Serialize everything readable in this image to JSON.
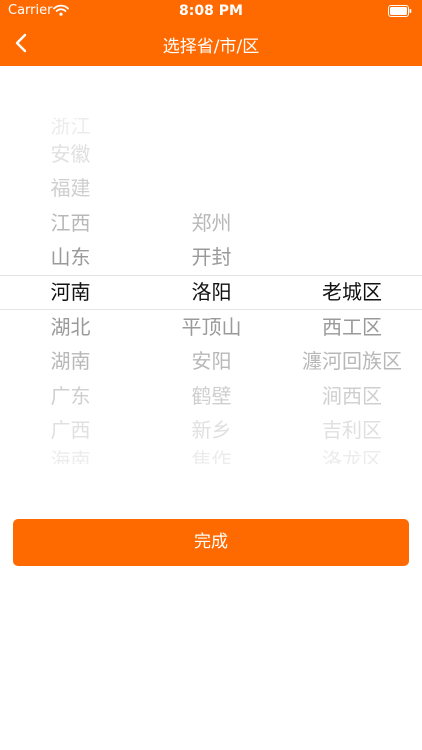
{
  "status_bar": {
    "carrier": "Carrier",
    "time": "8:08 PM"
  },
  "nav": {
    "title": "选择省/市/区"
  },
  "picker": {
    "province": {
      "items": [
        "浙江",
        "安徽",
        "福建",
        "江西",
        "山东",
        "河南",
        "湖北",
        "湖南",
        "广东",
        "广西",
        "海南"
      ],
      "selected": "河南"
    },
    "city": {
      "items": [
        "郑州",
        "开封",
        "洛阳",
        "平顶山",
        "安阳",
        "鹤壁",
        "新乡",
        "焦作"
      ],
      "selected": "洛阳"
    },
    "district": {
      "items": [
        "老城区",
        "西工区",
        "瀍河回族区",
        "涧西区",
        "吉利区",
        "洛龙区"
      ],
      "selected": "老城区"
    }
  },
  "done_button": {
    "label": "完成"
  },
  "colors": {
    "accent": "#ff6a00"
  }
}
